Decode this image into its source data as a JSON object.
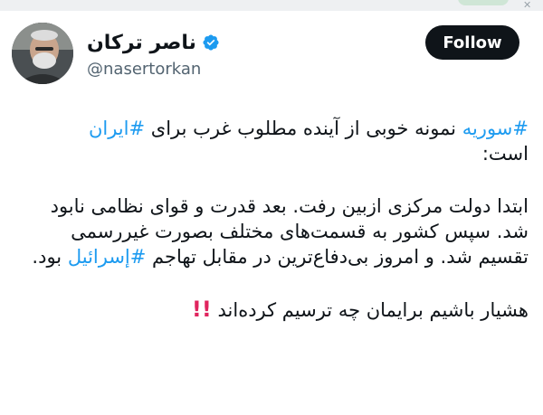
{
  "user": {
    "display_name": "ناصر ترکان",
    "handle": "@nasertorkan",
    "verified": true
  },
  "follow_button": {
    "label": "Follow"
  },
  "tweet": {
    "line1_tag_a": "#سوریه",
    "line1_text": " نمونه خوبی از آینده مطلوب غرب برای ",
    "line1_tag_b": "#ایران",
    "line2_text": "است:",
    "para2_text": "ابتدا دولت مرکزی ازبین رفت. بعد قدرت و قوای نظامی نابود شد. سپس کشور به قسمت‌های مختلف بصورت غیررسمی تقسیم شد. و امروز بی‌دفاع‌ترین در مقابل تهاجم ",
    "para2_tag": "#إسرائيل",
    "para2_end": " بود.",
    "para3_text": "هشیار باشیم برایمان چه ترسیم کرده‌اند ",
    "para3_emoji": "!!"
  },
  "icons": {
    "verified": "verified-badge-icon",
    "close": "close-icon"
  },
  "colors": {
    "link": "#1d9bf0",
    "follow_bg": "#0f1419",
    "verified": "#1d9bf0",
    "emoji": "#e0245e"
  }
}
